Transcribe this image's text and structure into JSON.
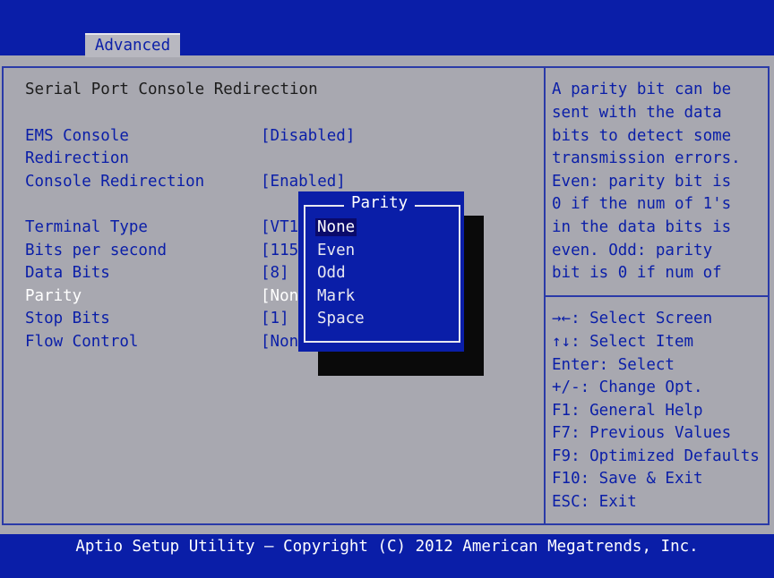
{
  "tabs": {
    "active_tab": "Advanced"
  },
  "main": {
    "section_title": "Serial Port Console Redirection",
    "items": [
      {
        "label_line1": "EMS Console",
        "label_line2": "Redirection",
        "value": "[Disabled]"
      },
      {
        "label": "Console Redirection",
        "value": "[Enabled]"
      },
      {
        "label": "Terminal Type",
        "value": "[VT1"
      },
      {
        "label": "Bits per second",
        "value": "[115"
      },
      {
        "label": "Data Bits",
        "value": "[8]"
      },
      {
        "label": "Parity",
        "value": "[Non"
      },
      {
        "label": "Stop Bits",
        "value": "[1]"
      },
      {
        "label": "Flow Control",
        "value": "[Non"
      }
    ]
  },
  "popup": {
    "title": "Parity",
    "options": [
      "None",
      "Even",
      "Odd",
      "Mark",
      "Space"
    ],
    "selected": "None"
  },
  "help": {
    "lines": [
      "A parity bit can be",
      "sent with the data",
      "bits to detect some",
      "transmission errors.",
      "Even: parity bit is",
      "0 if the num of 1's",
      "in the data bits is",
      "even. Odd: parity",
      "bit is 0 if num of"
    ],
    "keys": [
      "→←: Select Screen",
      "↑↓: Select Item",
      "Enter: Select",
      "+/-: Change Opt.",
      "F1: General Help",
      "F7: Previous Values",
      "F9: Optimized Defaults",
      "F10: Save & Exit",
      "ESC: Exit"
    ]
  },
  "footer": {
    "text": "Aptio Setup Utility – Copyright (C) 2012 American Megatrends, Inc."
  },
  "colors": {
    "bios_blue": "#0a1ea8",
    "panel_gray": "#a8a8b0",
    "highlight_white": "#ffffff"
  }
}
